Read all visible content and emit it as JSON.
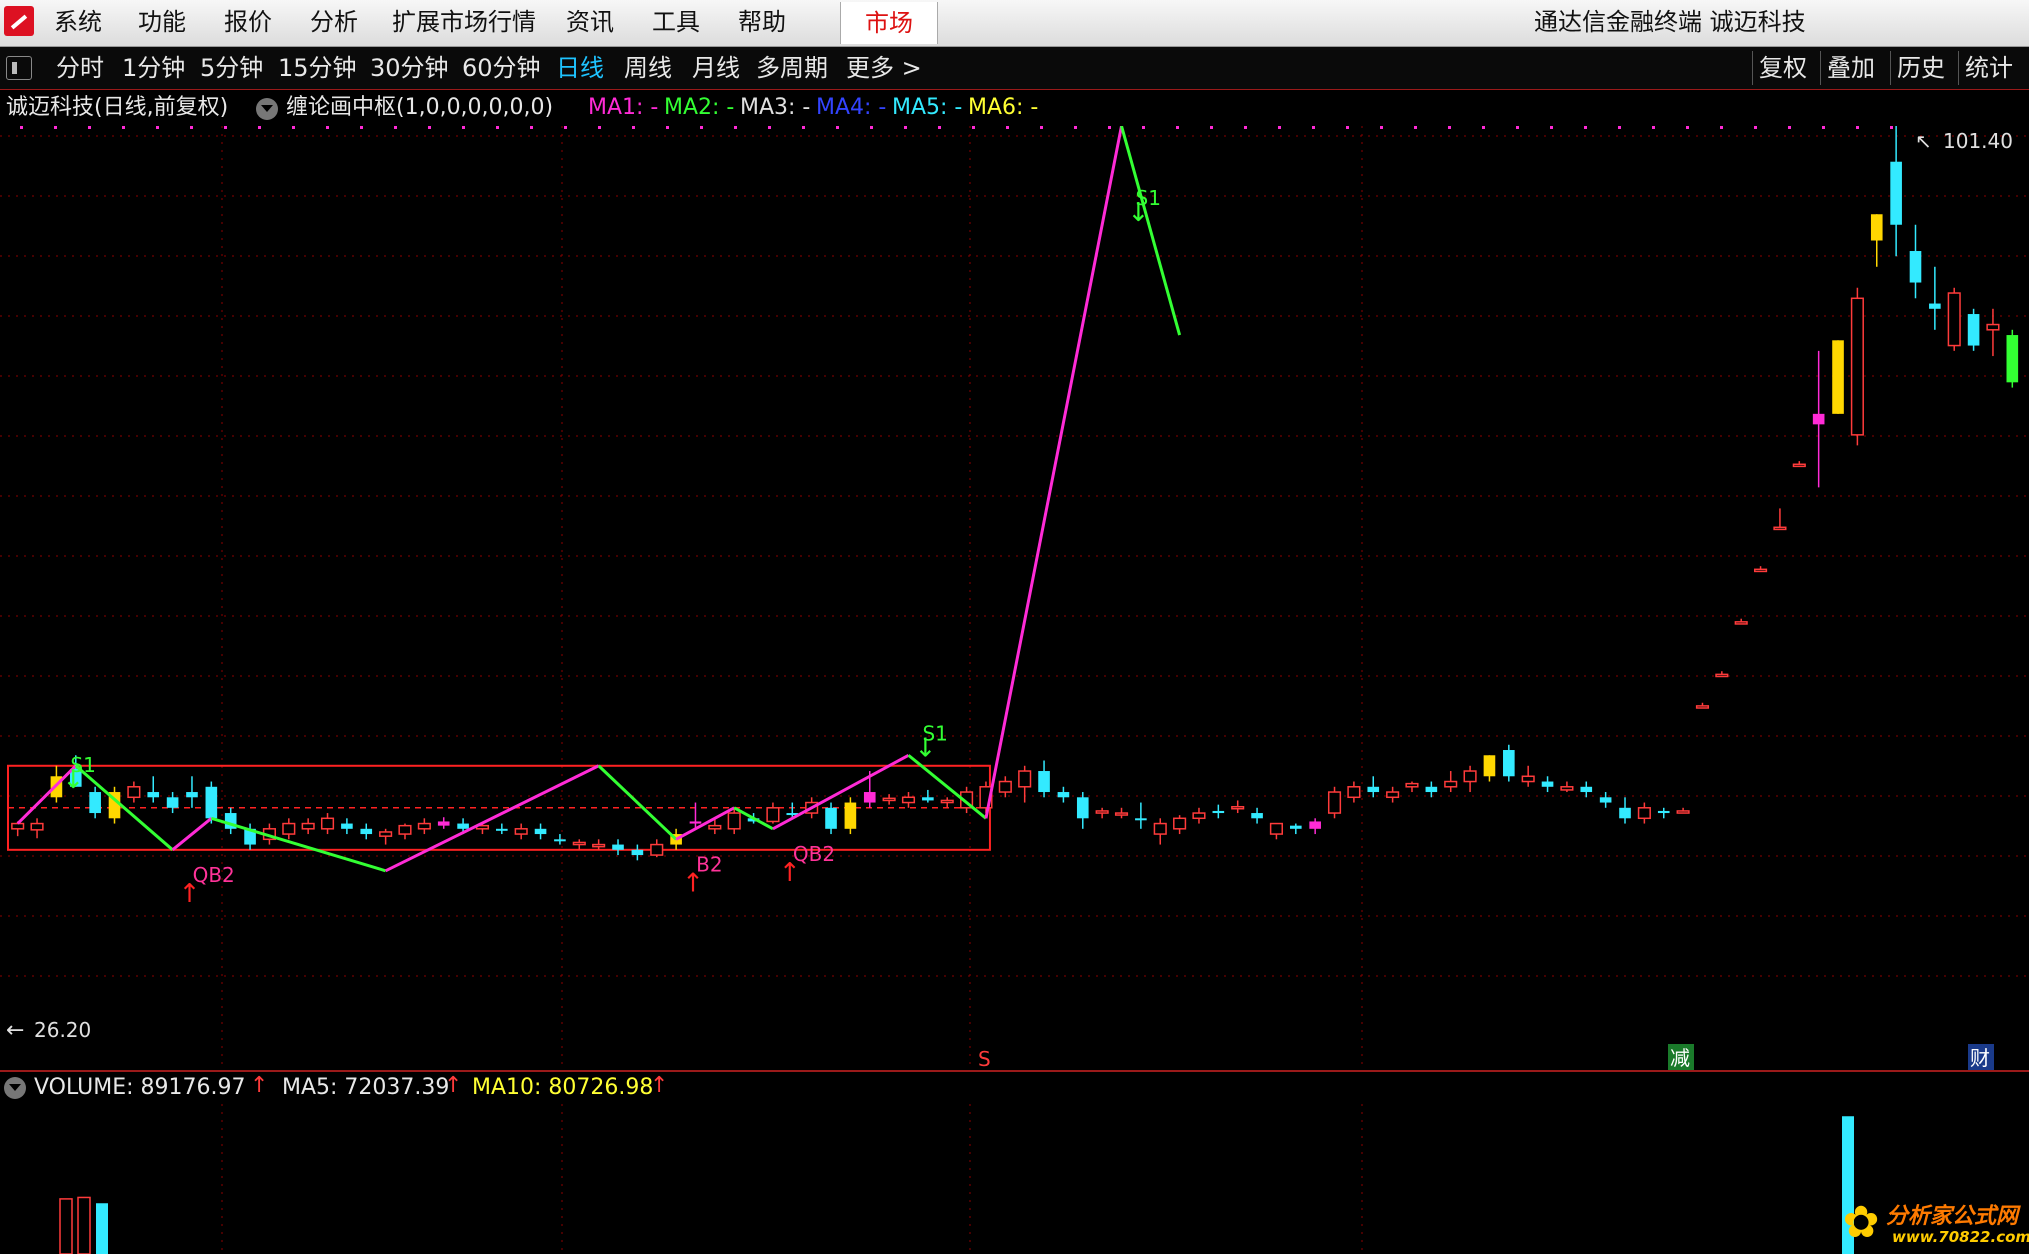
{
  "menubar": {
    "items": [
      "系统",
      "功能",
      "报价",
      "分析",
      "扩展市场行情",
      "资讯",
      "工具",
      "帮助"
    ],
    "market_tab": "市场",
    "app_title": "通达信金融终端  诚迈科技"
  },
  "toolbar": {
    "periods": [
      "分时",
      "1分钟",
      "5分钟",
      "15分钟",
      "30分钟",
      "60分钟",
      "日线",
      "周线",
      "月线",
      "多周期",
      "更多 >"
    ],
    "active_period": "日线",
    "right_buttons": [
      "复权",
      "叠加",
      "历史",
      "统计"
    ]
  },
  "chart_header": {
    "stock": "诚迈科技(日线,前复权)",
    "indicator": "缠论画中枢(1,0,0,0,0,0,0)",
    "ma": [
      {
        "label": "MA1: -",
        "color": "#ff2bd6"
      },
      {
        "label": "MA2: -",
        "color": "#33ff33"
      },
      {
        "label": "MA3: -",
        "color": "#e0e0e0"
      },
      {
        "label": "MA4: -",
        "color": "#3344ff"
      },
      {
        "label": "MA5: -",
        "color": "#33eaff"
      },
      {
        "label": "MA6: -",
        "color": "#ffff33"
      }
    ]
  },
  "price_labels": {
    "high": "101.40",
    "low": "26.20"
  },
  "signals": [
    {
      "text": "QB2",
      "color": "#ff3399",
      "arrow": "up"
    },
    {
      "text": "B2",
      "color": "#ff3399",
      "arrow": "up"
    },
    {
      "text": "QB2",
      "color": "#ff3399",
      "arrow": "up"
    },
    {
      "text": "S1",
      "color": "#33ff33",
      "arrow": "down"
    },
    {
      "text": "S1",
      "color": "#33ff33",
      "arrow": "down"
    },
    {
      "text": "S1",
      "color": "#33ff33",
      "arrow": "down"
    }
  ],
  "markers": {
    "s": "S",
    "jian": "减",
    "cai": "财"
  },
  "volume_header": {
    "volume": "VOLUME: 89176.97",
    "ma5": "MA5: 72037.39",
    "ma10": "MA10: 80726.98"
  },
  "watermark": {
    "text": "分析家公式网",
    "url": "www.70822.com"
  },
  "colors": {
    "up": "#ff3b3b",
    "down": "#33eaff",
    "pink_line": "#ff2bd6",
    "green_line": "#33ff33",
    "grid": "#8b0000",
    "zone": "#ff2222",
    "yellow": "#ffd700"
  },
  "chart_data": {
    "type": "candlestick",
    "title": "诚迈科技(日线,前复权)",
    "labels": {
      "high_price": 101.4,
      "low_price": 26.2
    },
    "zone": {
      "upper": 40.5,
      "mid": 36.5,
      "lower": 32.5
    },
    "bi_points": [
      {
        "i": 0,
        "p": 35
      },
      {
        "i": 3,
        "p": 40.5
      },
      {
        "i": 8,
        "p": 32.5
      },
      {
        "i": 10,
        "p": 35.5
      },
      {
        "i": 19,
        "p": 30.5
      },
      {
        "i": 30,
        "p": 40.5
      },
      {
        "i": 34,
        "p": 33.5
      },
      {
        "i": 37,
        "p": 36.5
      },
      {
        "i": 39,
        "p": 34.5
      },
      {
        "i": 46,
        "p": 41.5
      },
      {
        "i": 50,
        "p": 35.5
      },
      {
        "i": 57,
        "p": 101.4
      },
      {
        "i": 60,
        "p": 81.5
      }
    ],
    "candles": [
      {
        "o": 34.5,
        "h": 35.2,
        "l": 33.8,
        "c": 35.0,
        "t": "up"
      },
      {
        "o": 34.4,
        "h": 35.5,
        "l": 33.6,
        "c": 35.0,
        "t": "up"
      },
      {
        "o": 39.5,
        "h": 40.5,
        "l": 37.0,
        "c": 37.5,
        "t": "yellow"
      },
      {
        "o": 40.2,
        "h": 41.5,
        "l": 38.5,
        "c": 38.5,
        "t": "down"
      },
      {
        "o": 38.0,
        "h": 38.5,
        "l": 35.5,
        "c": 36.0,
        "t": "down"
      },
      {
        "o": 35.5,
        "h": 38.5,
        "l": 35.0,
        "c": 38.0,
        "t": "yellow"
      },
      {
        "o": 37.5,
        "h": 39.0,
        "l": 37.0,
        "c": 38.5,
        "t": "up"
      },
      {
        "o": 38.0,
        "h": 39.5,
        "l": 37.0,
        "c": 37.5,
        "t": "down"
      },
      {
        "o": 37.5,
        "h": 38.0,
        "l": 36.0,
        "c": 36.5,
        "t": "down"
      },
      {
        "o": 37.5,
        "h": 39.5,
        "l": 36.5,
        "c": 38.0,
        "t": "down"
      },
      {
        "o": 38.5,
        "h": 39.0,
        "l": 35.0,
        "c": 35.5,
        "t": "down"
      },
      {
        "o": 36.0,
        "h": 36.5,
        "l": 34.0,
        "c": 34.5,
        "t": "down"
      },
      {
        "o": 34.5,
        "h": 35.0,
        "l": 32.5,
        "c": 33.0,
        "t": "down"
      },
      {
        "o": 33.5,
        "h": 35.0,
        "l": 33.0,
        "c": 34.5,
        "t": "up"
      },
      {
        "o": 34.0,
        "h": 35.5,
        "l": 33.5,
        "c": 35.0,
        "t": "up"
      },
      {
        "o": 34.5,
        "h": 35.5,
        "l": 34.0,
        "c": 35.0,
        "t": "up"
      },
      {
        "o": 34.5,
        "h": 36.0,
        "l": 34.0,
        "c": 35.5,
        "t": "up"
      },
      {
        "o": 35.0,
        "h": 35.5,
        "l": 34.0,
        "c": 34.5,
        "t": "down"
      },
      {
        "o": 34.5,
        "h": 35.0,
        "l": 33.5,
        "c": 34.0,
        "t": "down"
      },
      {
        "o": 33.8,
        "h": 34.5,
        "l": 33.0,
        "c": 34.2,
        "t": "up"
      },
      {
        "o": 34.0,
        "h": 35.0,
        "l": 33.5,
        "c": 34.8,
        "t": "up"
      },
      {
        "o": 34.5,
        "h": 35.5,
        "l": 34.0,
        "c": 35.0,
        "t": "up"
      },
      {
        "o": 34.8,
        "h": 35.6,
        "l": 34.5,
        "c": 35.2,
        "t": "pink"
      },
      {
        "o": 35.0,
        "h": 35.5,
        "l": 34.0,
        "c": 34.5,
        "t": "down"
      },
      {
        "o": 34.5,
        "h": 35.0,
        "l": 34.0,
        "c": 34.8,
        "t": "up"
      },
      {
        "o": 34.5,
        "h": 35.0,
        "l": 34.0,
        "c": 34.5,
        "t": "down"
      },
      {
        "o": 34.5,
        "h": 35.0,
        "l": 33.5,
        "c": 34.0,
        "t": "up"
      },
      {
        "o": 34.5,
        "h": 35.0,
        "l": 33.5,
        "c": 34.0,
        "t": "down"
      },
      {
        "o": 33.5,
        "h": 34.0,
        "l": 33.0,
        "c": 33.5,
        "t": "down"
      },
      {
        "o": 33.0,
        "h": 33.5,
        "l": 32.5,
        "c": 33.2,
        "t": "up"
      },
      {
        "o": 33.0,
        "h": 33.5,
        "l": 32.5,
        "c": 32.8,
        "t": "up"
      },
      {
        "o": 33.0,
        "h": 33.5,
        "l": 32.0,
        "c": 32.5,
        "t": "down"
      },
      {
        "o": 32.5,
        "h": 33.0,
        "l": 31.5,
        "c": 32.0,
        "t": "down"
      },
      {
        "o": 32.0,
        "h": 33.5,
        "l": 31.8,
        "c": 33.0,
        "t": "up"
      },
      {
        "o": 33.0,
        "h": 34.5,
        "l": 32.5,
        "c": 34.0,
        "t": "yellow"
      },
      {
        "o": 35.0,
        "h": 37.0,
        "l": 34.5,
        "c": 35.2,
        "t": "pink"
      },
      {
        "o": 34.5,
        "h": 35.5,
        "l": 34.0,
        "c": 34.8,
        "t": "up"
      },
      {
        "o": 34.5,
        "h": 36.5,
        "l": 34.0,
        "c": 36.0,
        "t": "up"
      },
      {
        "o": 35.5,
        "h": 36.0,
        "l": 35.0,
        "c": 35.2,
        "t": "down"
      },
      {
        "o": 35.2,
        "h": 37.0,
        "l": 35.0,
        "c": 36.5,
        "t": "up"
      },
      {
        "o": 36.0,
        "h": 37.0,
        "l": 35.5,
        "c": 36.0,
        "t": "down"
      },
      {
        "o": 36.0,
        "h": 37.5,
        "l": 35.5,
        "c": 37.0,
        "t": "up"
      },
      {
        "o": 36.5,
        "h": 37.0,
        "l": 34.0,
        "c": 34.5,
        "t": "down"
      },
      {
        "o": 34.5,
        "h": 37.5,
        "l": 34.0,
        "c": 37.0,
        "t": "yellow"
      },
      {
        "o": 38.0,
        "h": 40.0,
        "l": 36.5,
        "c": 37.0,
        "t": "pink"
      },
      {
        "o": 37.2,
        "h": 37.8,
        "l": 36.8,
        "c": 37.4,
        "t": "up"
      },
      {
        "o": 37.0,
        "h": 38.0,
        "l": 36.5,
        "c": 37.5,
        "t": "up"
      },
      {
        "o": 37.5,
        "h": 38.2,
        "l": 37.0,
        "c": 37.2,
        "t": "down"
      },
      {
        "o": 37.0,
        "h": 37.5,
        "l": 36.5,
        "c": 37.2,
        "t": "up"
      },
      {
        "o": 36.5,
        "h": 38.5,
        "l": 36.0,
        "c": 38.0,
        "t": "up"
      },
      {
        "o": 36.5,
        "h": 39.0,
        "l": 36.0,
        "c": 38.5,
        "t": "up"
      },
      {
        "o": 38.0,
        "h": 39.5,
        "l": 37.5,
        "c": 39.0,
        "t": "up"
      },
      {
        "o": 38.5,
        "h": 40.5,
        "l": 37.0,
        "c": 40.0,
        "t": "up"
      },
      {
        "o": 40.0,
        "h": 41.0,
        "l": 37.5,
        "c": 38.0,
        "t": "down"
      },
      {
        "o": 38.0,
        "h": 38.5,
        "l": 37.0,
        "c": 37.5,
        "t": "down"
      },
      {
        "o": 37.5,
        "h": 38.0,
        "l": 34.5,
        "c": 35.5,
        "t": "down"
      },
      {
        "o": 36.0,
        "h": 36.5,
        "l": 35.5,
        "c": 36.2,
        "t": "up"
      },
      {
        "o": 36.0,
        "h": 36.5,
        "l": 35.5,
        "c": 36.0,
        "t": "up"
      },
      {
        "o": 35.5,
        "h": 37.0,
        "l": 34.5,
        "c": 35.5,
        "t": "down"
      },
      {
        "o": 34.0,
        "h": 35.5,
        "l": 33.0,
        "c": 35.0,
        "t": "up"
      },
      {
        "o": 34.5,
        "h": 35.8,
        "l": 34.0,
        "c": 35.5,
        "t": "up"
      },
      {
        "o": 35.5,
        "h": 36.5,
        "l": 35.0,
        "c": 36.0,
        "t": "up"
      },
      {
        "o": 36.0,
        "h": 36.8,
        "l": 35.5,
        "c": 36.2,
        "t": "down"
      },
      {
        "o": 36.5,
        "h": 37.2,
        "l": 36.0,
        "c": 36.6,
        "t": "up"
      },
      {
        "o": 36.0,
        "h": 36.5,
        "l": 35.0,
        "c": 35.5,
        "t": "down"
      },
      {
        "o": 34.0,
        "h": 35.0,
        "l": 33.5,
        "c": 35.0,
        "t": "up"
      },
      {
        "o": 34.5,
        "h": 35.0,
        "l": 34.0,
        "c": 34.8,
        "t": "down"
      },
      {
        "o": 34.5,
        "h": 35.5,
        "l": 34.0,
        "c": 35.2,
        "t": "pink"
      },
      {
        "o": 36.0,
        "h": 38.5,
        "l": 35.5,
        "c": 38.0,
        "t": "up"
      },
      {
        "o": 37.5,
        "h": 39.0,
        "l": 37.0,
        "c": 38.5,
        "t": "up"
      },
      {
        "o": 38.0,
        "h": 39.5,
        "l": 37.5,
        "c": 38.5,
        "t": "down"
      },
      {
        "o": 38.0,
        "h": 38.5,
        "l": 37.0,
        "c": 37.5,
        "t": "up"
      },
      {
        "o": 38.5,
        "h": 39.0,
        "l": 38.0,
        "c": 38.8,
        "t": "up"
      },
      {
        "o": 38.0,
        "h": 39.0,
        "l": 37.5,
        "c": 38.5,
        "t": "down"
      },
      {
        "o": 38.5,
        "h": 40.0,
        "l": 38.0,
        "c": 39.0,
        "t": "up"
      },
      {
        "o": 39.0,
        "h": 40.5,
        "l": 38.0,
        "c": 40.0,
        "t": "up"
      },
      {
        "o": 41.5,
        "h": 41.5,
        "l": 39.0,
        "c": 39.5,
        "t": "yellow"
      },
      {
        "o": 42.0,
        "h": 42.5,
        "l": 39.0,
        "c": 39.5,
        "t": "down"
      },
      {
        "o": 39.5,
        "h": 40.5,
        "l": 38.5,
        "c": 39.0,
        "t": "up"
      },
      {
        "o": 39.0,
        "h": 39.5,
        "l": 38.0,
        "c": 38.5,
        "t": "down"
      },
      {
        "o": 38.5,
        "h": 39.0,
        "l": 38.0,
        "c": 38.2,
        "t": "up"
      },
      {
        "o": 38.5,
        "h": 39.0,
        "l": 37.5,
        "c": 38.0,
        "t": "down"
      },
      {
        "o": 37.5,
        "h": 38.0,
        "l": 36.5,
        "c": 37.0,
        "t": "down"
      },
      {
        "o": 36.5,
        "h": 37.5,
        "l": 35.0,
        "c": 35.5,
        "t": "down"
      },
      {
        "o": 35.5,
        "h": 37.0,
        "l": 35.0,
        "c": 36.5,
        "t": "up"
      },
      {
        "o": 36.0,
        "h": 36.5,
        "l": 35.5,
        "c": 36.2,
        "t": "down"
      },
      {
        "o": 36.0,
        "h": 36.5,
        "l": 36.0,
        "c": 36.2,
        "t": "up"
      },
      {
        "o": 46.0,
        "h": 46.5,
        "l": 46.0,
        "c": 46.2,
        "t": "up"
      },
      {
        "o": 49.0,
        "h": 49.5,
        "l": 49.0,
        "c": 49.2,
        "t": "up"
      },
      {
        "o": 54.0,
        "h": 54.5,
        "l": 54.0,
        "c": 54.2,
        "t": "up"
      },
      {
        "o": 59.0,
        "h": 59.5,
        "l": 59.0,
        "c": 59.2,
        "t": "up"
      },
      {
        "o": 63.0,
        "h": 65.0,
        "l": 63.0,
        "c": 63.2,
        "t": "up"
      },
      {
        "o": 69.0,
        "h": 69.5,
        "l": 69.0,
        "c": 69.2,
        "t": "up"
      },
      {
        "o": 73.0,
        "h": 80.0,
        "l": 67.0,
        "c": 74.0,
        "t": "pink"
      },
      {
        "o": 81.0,
        "h": 81.0,
        "l": 74.0,
        "c": 74.0,
        "t": "yellow"
      },
      {
        "o": 72.0,
        "h": 86.0,
        "l": 71.0,
        "c": 85.0,
        "t": "up"
      },
      {
        "o": 90.5,
        "h": 93.0,
        "l": 88.0,
        "c": 93.0,
        "t": "yellow"
      },
      {
        "o": 98.0,
        "h": 101.4,
        "l": 89.0,
        "c": 92.0,
        "t": "down"
      },
      {
        "o": 89.5,
        "h": 92.0,
        "l": 85.0,
        "c": 86.5,
        "t": "down"
      },
      {
        "o": 84.5,
        "h": 88.0,
        "l": 82.0,
        "c": 84.0,
        "t": "down"
      },
      {
        "o": 80.5,
        "h": 86.0,
        "l": 80.0,
        "c": 85.5,
        "t": "up"
      },
      {
        "o": 83.5,
        "h": 84.0,
        "l": 80.0,
        "c": 80.5,
        "t": "down"
      },
      {
        "o": 82.5,
        "h": 84.0,
        "l": 79.5,
        "c": 82.0,
        "t": "up"
      },
      {
        "o": 81.5,
        "h": 82.0,
        "l": 76.5,
        "c": 77.0,
        "t": "green"
      }
    ],
    "volume": {
      "current": 89176.97,
      "ma5": 72037.39,
      "ma10": 80726.98,
      "bars": [
        {
          "v": 76000,
          "t": "up"
        },
        {
          "v": 78000,
          "t": "up"
        },
        {
          "v": 70000,
          "t": "down"
        },
        {
          "v": 190000,
          "t": "down"
        }
      ]
    }
  }
}
